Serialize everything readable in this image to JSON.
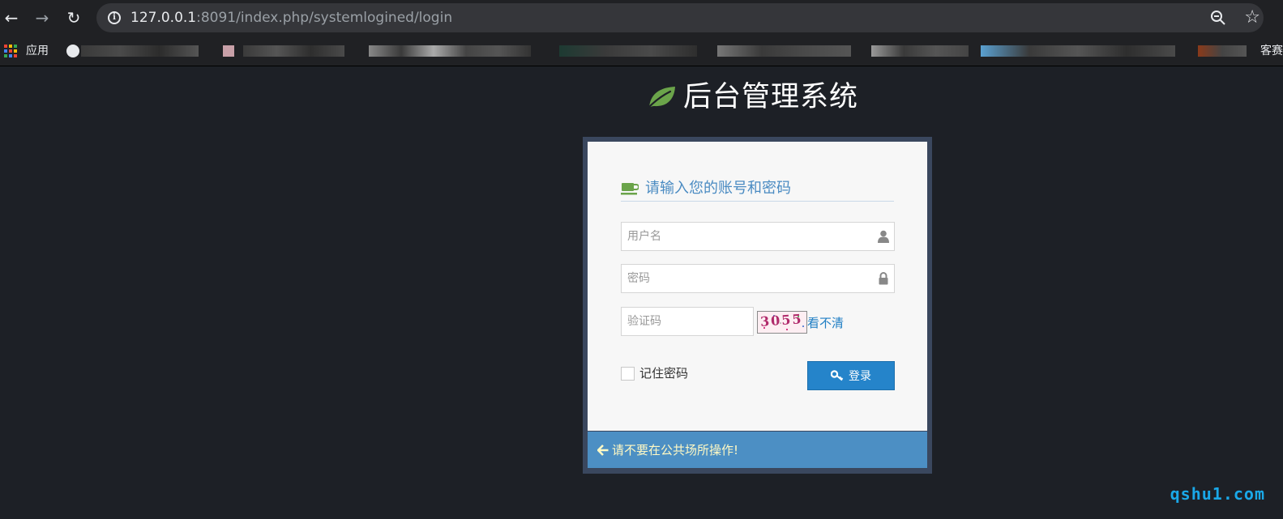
{
  "browser": {
    "url_host": "127.0.0.1",
    "url_rest": ":8091/index.php/systemlogined/login",
    "bookmarks_apps_label": "应用",
    "bookmarks_tail": "客赛"
  },
  "page": {
    "title": "后台管理系统",
    "box_header": "请输入您的账号和密码",
    "username_placeholder": "用户名",
    "password_placeholder": "密码",
    "captcha_placeholder": "验证码",
    "captcha_code": "3055",
    "captcha_refresh": "看不清",
    "remember_label": "记住密码",
    "login_label": "登录",
    "footer_notice": "请不要在公共场所操作!",
    "watermark": "qshu1.com"
  },
  "colors": {
    "background": "#1d2026",
    "accent_leaf": "#6ba44a",
    "header_blue": "#4a8bc2",
    "button_blue": "#2584ca",
    "footer_blue": "#4c8fc4",
    "footer_text": "#fff9c4"
  },
  "icons": {
    "title": "leaf-icon",
    "box_header": "coffee-icon",
    "username": "user-icon",
    "password": "lock-icon",
    "login": "key-icon",
    "footer": "arrow-left-icon"
  }
}
